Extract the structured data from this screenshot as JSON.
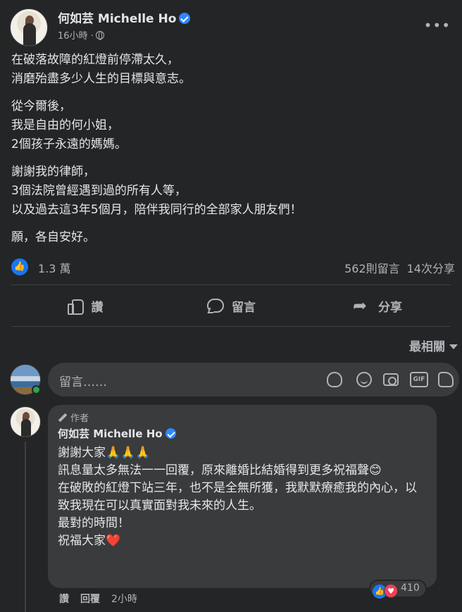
{
  "post": {
    "author": "何如芸 Michelle Ho",
    "time": "16小時 ·",
    "paragraphs": [
      "在破落故障的紅燈前停滯太久，\n消磨殆盡多少人生的目標與意志。",
      "從今爾後，\n我是自由的何小姐，\n2個孩子永遠的媽媽。",
      "謝謝我的律師，\n3個法院曾經遇到過的所有人等，\n以及過去這3年5個月，陪伴我同行的全部家人朋友們！",
      "願，各自安好。"
    ],
    "likes": "1.3 萬",
    "comments_count": "562則留言",
    "shares_count": "14次分享"
  },
  "actions": {
    "like": "讚",
    "comment": "留言",
    "share": "分享"
  },
  "sort_label": "最相關",
  "composer": {
    "placeholder": "留言……"
  },
  "reply": {
    "badge": "作者",
    "author": "何如芸 Michelle Ho",
    "text": "謝謝大家🙏🙏🙏\n訊息量太多無法一一回覆，原來離婚比結婚得到更多祝福聲😊\n在破敗的紅燈下站三年，也不是全無所獲，我默默療癒我的內心，以致我現在可以真實面對我未來的人生。\n最對的時間！\n祝福大家❤️",
    "reaction_count": "410",
    "like_label": "讚",
    "reply_label": "回覆",
    "time": "2小時"
  },
  "colors": {
    "background": "#242526",
    "surface": "#3a3b3c",
    "accent": "#1877f2",
    "love": "#f33e58",
    "online": "#31a24c"
  }
}
